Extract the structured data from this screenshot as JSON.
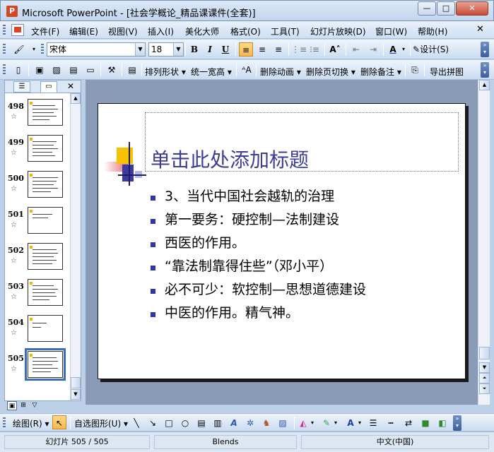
{
  "window": {
    "title": "Microsoft PowerPoint - [社会学概论_精品课课件(全套)]",
    "app_icon": "powerpoint-icon",
    "minimize": "—",
    "maximize": "□",
    "close": "✕"
  },
  "menu": {
    "items": [
      "文件(F)",
      "编辑(E)",
      "视图(V)",
      "插入(I)",
      "美化大师",
      "格式(O)",
      "工具(T)",
      "幻灯片放映(D)",
      "窗口(W)",
      "帮助(H)"
    ],
    "close": "✕"
  },
  "toolbar1": {
    "font_name": "宋体",
    "font_size": "18",
    "bold": "B",
    "italic": "I",
    "underline": "U",
    "design_label": "设计(S)"
  },
  "toolbar2": {
    "arrange_shapes": "排列形状",
    "unify_width": "统一宽高",
    "delete_animation": "删除动画",
    "delete_transition": "删除页切换",
    "delete_notes": "删除备注",
    "export_image": "导出拼图"
  },
  "slides_panel": {
    "thumbnails": [
      {
        "number": "498",
        "star": "☆"
      },
      {
        "number": "499",
        "star": "☆"
      },
      {
        "number": "500",
        "star": "☆"
      },
      {
        "number": "501",
        "star": "☆"
      },
      {
        "number": "502",
        "star": "☆"
      },
      {
        "number": "503",
        "star": "☆"
      },
      {
        "number": "504",
        "star": "☆"
      },
      {
        "number": "505",
        "star": "☆"
      }
    ],
    "selected": "505"
  },
  "slide": {
    "title": "单击此处添加标题",
    "bullets": [
      "3、当代中国社会越轨的治理",
      "第一要务：硬控制—法制建设",
      "西医的作用。",
      "“靠法制靠得住些”（邓小平）",
      "必不可少：软控制—思想道德建设",
      "中医的作用。精气神。"
    ],
    "accent_colors": {
      "yellow": "#f7c300",
      "red": "#e0524f",
      "blue": "#3a3aa0",
      "title": "#3d3d9a"
    }
  },
  "drawbar": {
    "draw_label": "绘图(R)",
    "autoshapes_label": "自选图形(U)"
  },
  "status": {
    "slide_counter": "幻灯片 505 / 505",
    "design": "Blends",
    "language": "中文(中国)"
  }
}
